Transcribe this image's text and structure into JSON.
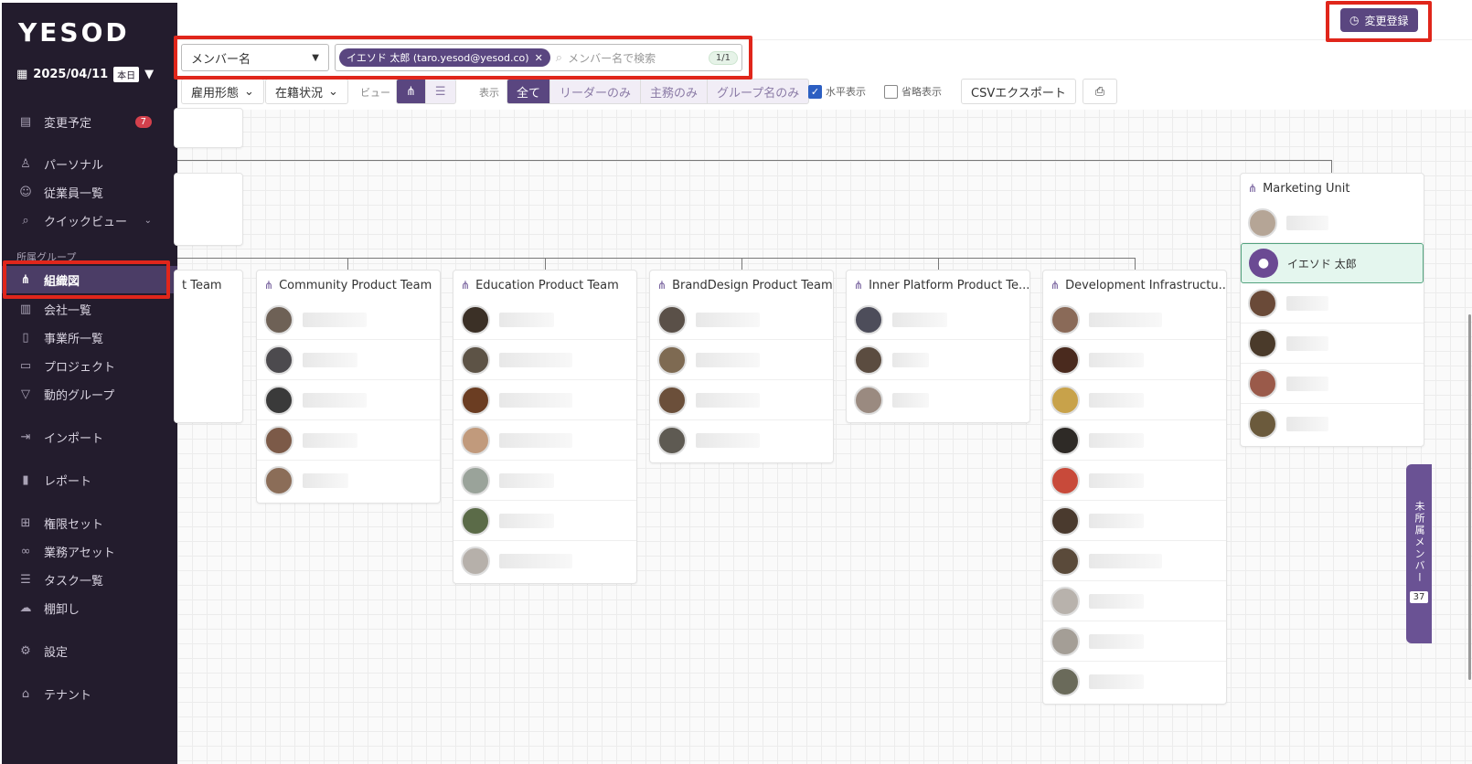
{
  "sidebar": {
    "logo": "YESOD",
    "date": "2025/04/11",
    "today": "本日",
    "pending_label": "変更予定",
    "pending_count": "7",
    "personal": "パーソナル",
    "employees": "従業員一覧",
    "quickview": "クイックビュー",
    "section_group": "所属グループ",
    "orgchart": "組織図",
    "companies": "会社一覧",
    "offices": "事業所一覧",
    "projects": "プロジェクト",
    "dynamic_groups": "動的グループ",
    "import": "インポート",
    "report": "レポート",
    "permission_set": "権限セット",
    "business_assets": "業務アセット",
    "tasks": "タスク一覧",
    "inventory": "棚卸し",
    "settings": "設定",
    "tenant": "テナント"
  },
  "topbar": {
    "change_register": "変更登録"
  },
  "filters": {
    "member_select": "メンバー名",
    "chip_label": "イエソド 太郎 (taro.yesod@yesod.co)",
    "search_placeholder": "メンバー名で検索",
    "result_count": "1/1",
    "employment_type": "雇用形態",
    "enrollment_status": "在籍状況",
    "view_label": "ビュー",
    "display_label": "表示",
    "display_all": "全て",
    "display_leaders": "リーダーのみ",
    "display_primary": "主務のみ",
    "display_group_names": "グループ名のみ",
    "horizontal": "水平表示",
    "abbreviated": "省略表示",
    "csv_export": "CSVエクスポート"
  },
  "org": {
    "partial_team": "t Team",
    "community": "Community Product Team",
    "education": "Education Product Team",
    "branddesign": "BrandDesign Product Team",
    "inner_platform": "Inner Platform Product Te...",
    "dev_infra": "Development Infrastructu...",
    "marketing": "Marketing Unit",
    "highlighted_member": "イエソド 太郎"
  },
  "side_tab": {
    "label": "未所属メンバー",
    "count": "37"
  }
}
